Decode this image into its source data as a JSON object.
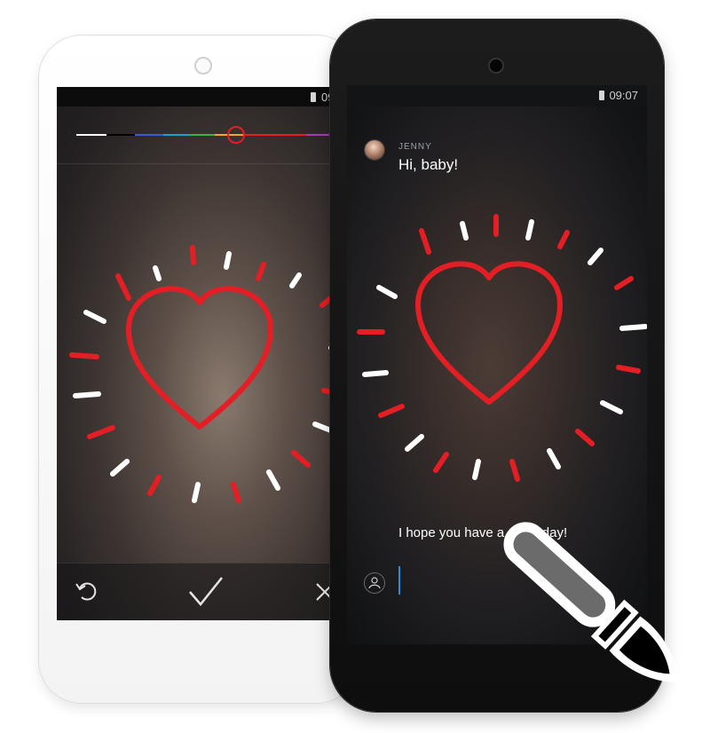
{
  "white_phone": {
    "status": {
      "time": "09"
    },
    "palette": {
      "swatches": [
        "#ffffff",
        "#000000",
        "#3b5bd6",
        "#17a2c8",
        "#3cb043",
        "#f5a623",
        "#e31e24",
        "#a53ab6"
      ],
      "selected_color": "#e31e24",
      "selected_fraction": 0.63
    },
    "toolbar": {
      "undo_icon": "undo-icon",
      "confirm_icon": "check-icon",
      "cancel_icon": "close-icon"
    }
  },
  "black_phone": {
    "status": {
      "time": "09:07"
    },
    "chat": {
      "sender": "JENNY",
      "message": "Hi, baby!",
      "caption": "I hope you have a great day!"
    },
    "composer": {
      "contact_icon": "person-icon"
    }
  },
  "drawing": {
    "heart_color": "#e31e24",
    "ray_colors": [
      "#ffffff",
      "#e31e24"
    ]
  },
  "logo": {
    "icon": "paintbrush-icon"
  }
}
